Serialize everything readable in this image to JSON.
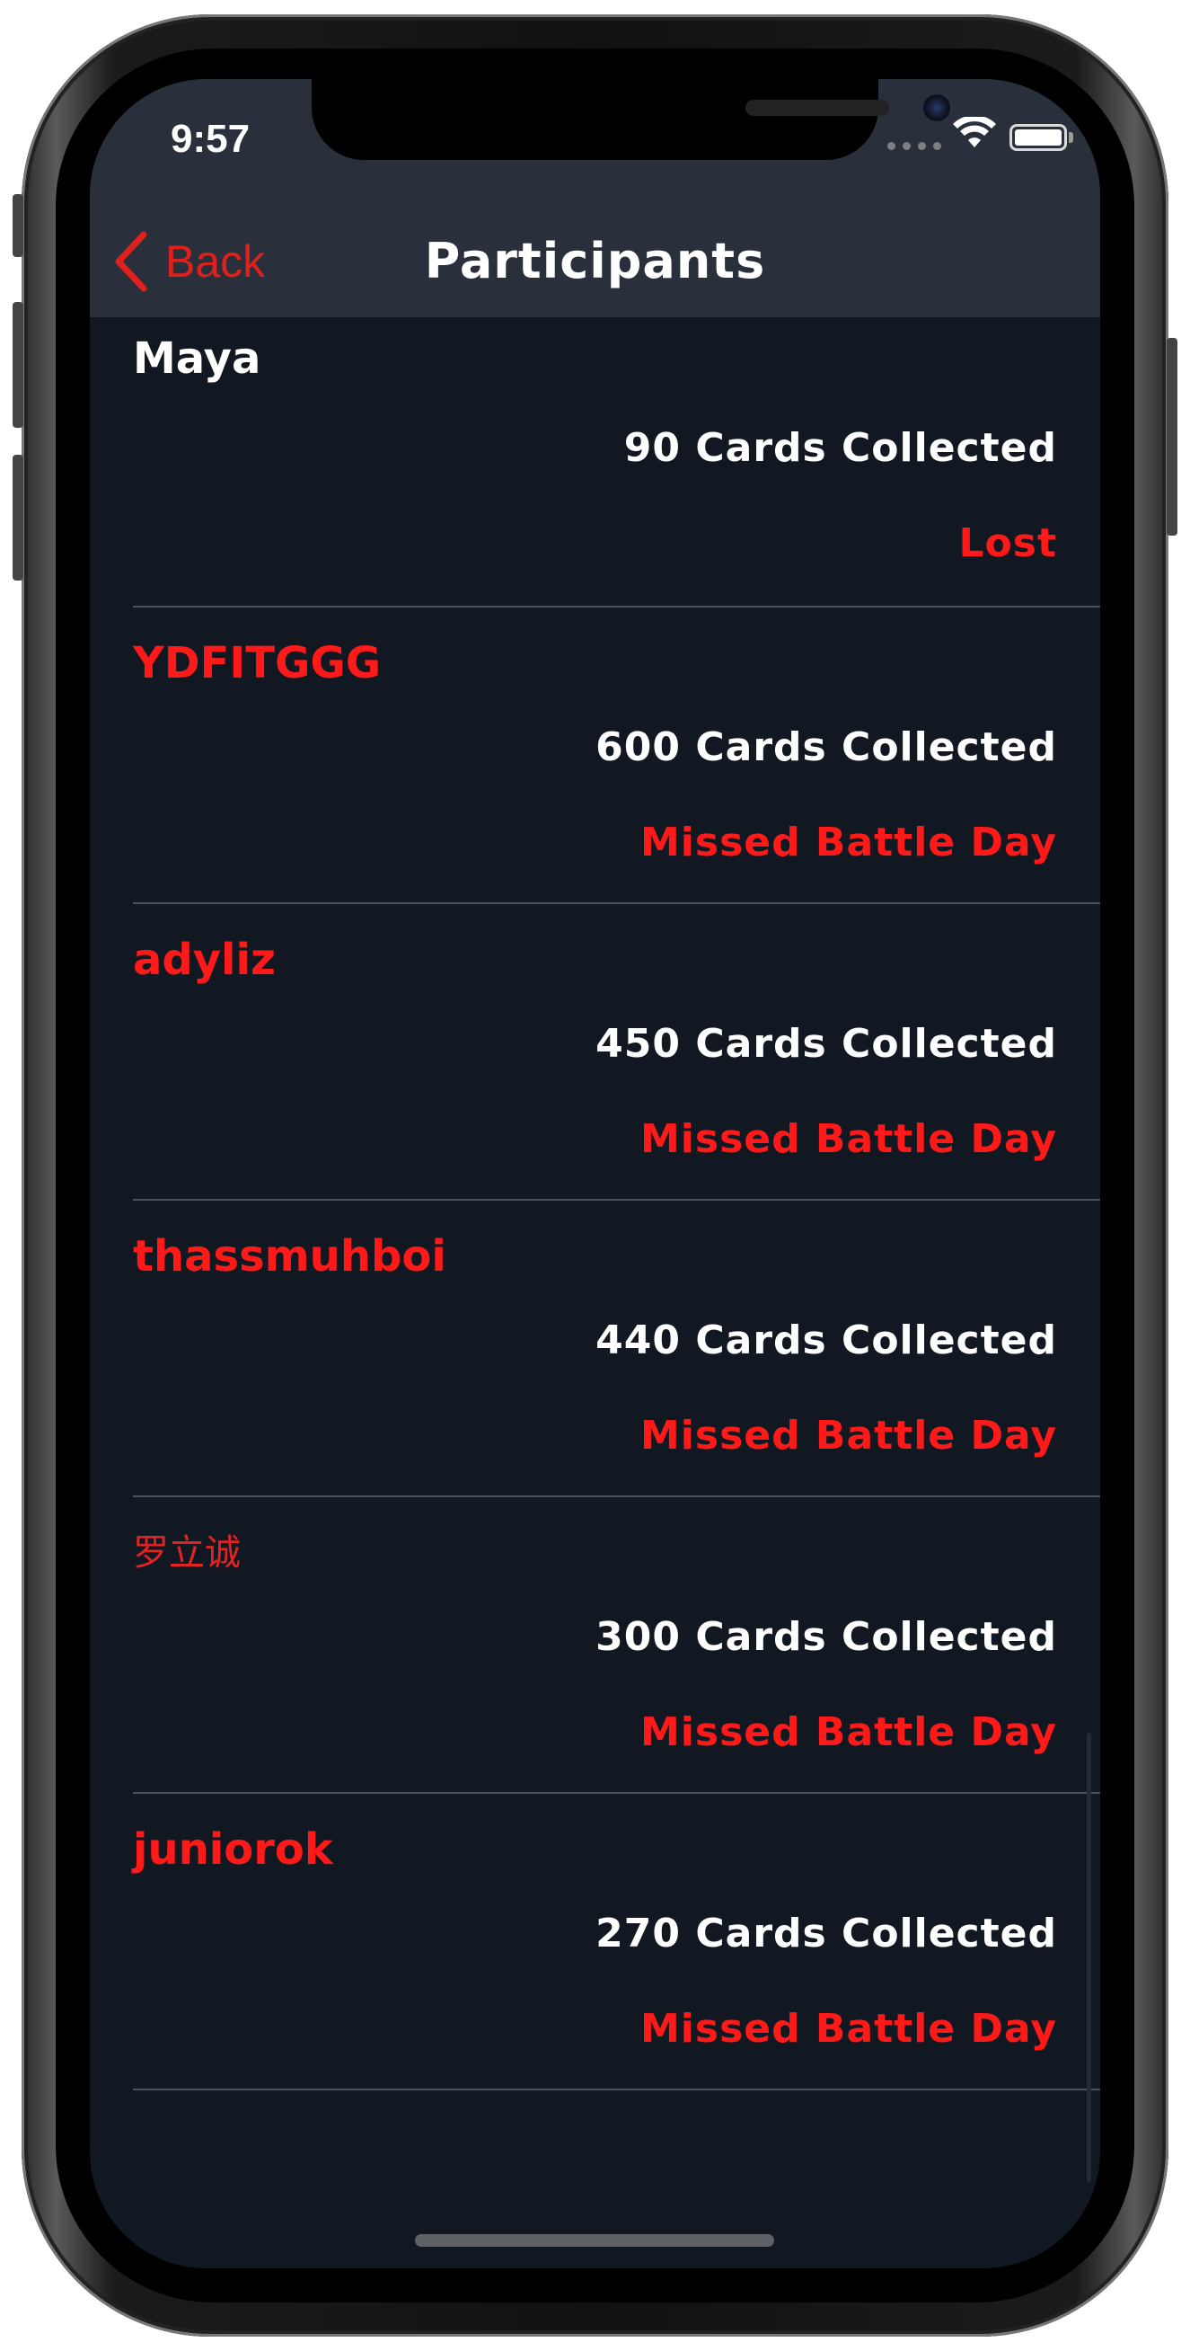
{
  "status_bar": {
    "time": "9:57"
  },
  "nav": {
    "back_label": "Back",
    "title": "Participants",
    "accent_color": "#e0201b"
  },
  "participants": [
    {
      "name": "Maya",
      "cards": "90 Cards Collected",
      "status": "Lost"
    },
    {
      "name": "YDFITGGG",
      "cards": "600 Cards Collected",
      "status": "Missed Battle Day"
    },
    {
      "name": "adyliz",
      "cards": "450 Cards Collected",
      "status": "Missed Battle Day"
    },
    {
      "name": "thassmuhboi",
      "cards": "440 Cards Collected",
      "status": "Missed Battle Day"
    },
    {
      "name": "罗立诚",
      "cards": "300 Cards Collected",
      "status": "Missed Battle Day"
    },
    {
      "name": "juniorok",
      "cards": "270 Cards Collected",
      "status": "Missed Battle Day"
    }
  ]
}
